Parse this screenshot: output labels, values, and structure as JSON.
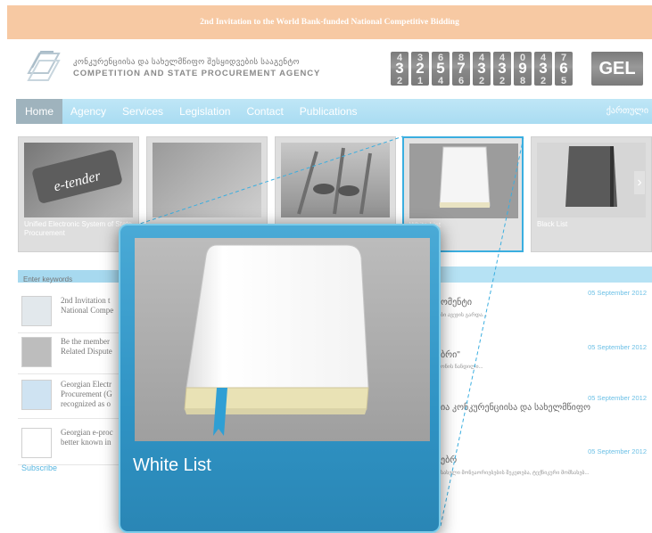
{
  "banner": {
    "text": "2nd Invitation to the World Bank-funded National Competitive Bidding"
  },
  "header": {
    "agency_ka": "კონკურენციისა და სახელმწიფო შესყიდვების სააგენტო",
    "agency_en": "COMPETITION AND STATE PROCUREMENT AGENCY",
    "counter": [
      {
        "top": "4",
        "main": "3",
        "bottom": "2"
      },
      {
        "top": "3",
        "main": "2",
        "bottom": "1"
      },
      {
        "top": "6",
        "main": "5",
        "bottom": "4"
      },
      {
        "top": "8",
        "main": "7",
        "bottom": "6"
      },
      {
        "top": "4",
        "main": "3",
        "bottom": "2"
      },
      {
        "top": "4",
        "main": "3",
        "bottom": "2"
      },
      {
        "top": "0",
        "main": "9",
        "bottom": "8"
      },
      {
        "top": "4",
        "main": "3",
        "bottom": "2"
      },
      {
        "top": "7",
        "main": "6",
        "bottom": "5"
      }
    ],
    "currency": "GEL"
  },
  "nav": {
    "items": [
      "Home",
      "Agency",
      "Services",
      "Legislation",
      "Contact",
      "Publications"
    ],
    "lang": "ქართული"
  },
  "slider": {
    "prev": "‹",
    "next": "›",
    "cards": [
      {
        "caption": "Unified Electronic System of State Procurement",
        "thumb_text": "e-tender"
      },
      {
        "caption": ""
      },
      {
        "caption": ""
      },
      {
        "caption": "White List"
      },
      {
        "caption": "Black List"
      }
    ]
  },
  "search": {
    "placeholder": "Enter keywords"
  },
  "news_left": [
    {
      "line1": "2nd Invitation t",
      "line2": "National Compe"
    },
    {
      "line1": "Be the member",
      "line2": "Related Dispute"
    },
    {
      "line1": "Georgian Electr",
      "line2": "Procurement (G",
      "line3": "recognized as o"
    },
    {
      "line1": "Georgian e-proc",
      "line2": "better known in"
    }
  ],
  "subscribe": "Subscribe",
  "news_right": [
    {
      "date": "05 September 2012",
      "title": "ომენტი",
      "sub": "ბი ავეჯის გარდა..."
    },
    {
      "date": "05 September 2012",
      "title": "ბრი\"",
      "sub": "ონის ნანდილი..."
    },
    {
      "date": "05 September 2012",
      "title": "ია კონკურენციისა და სახელმწიფო",
      "sub": ""
    },
    {
      "date": "05 September 2012",
      "title": "ებრ",
      "sub": "სახელი მონეაორიებების შეკეთება, ტექნიკური მომსახებ..."
    }
  ],
  "zoom": {
    "label": "White List"
  }
}
